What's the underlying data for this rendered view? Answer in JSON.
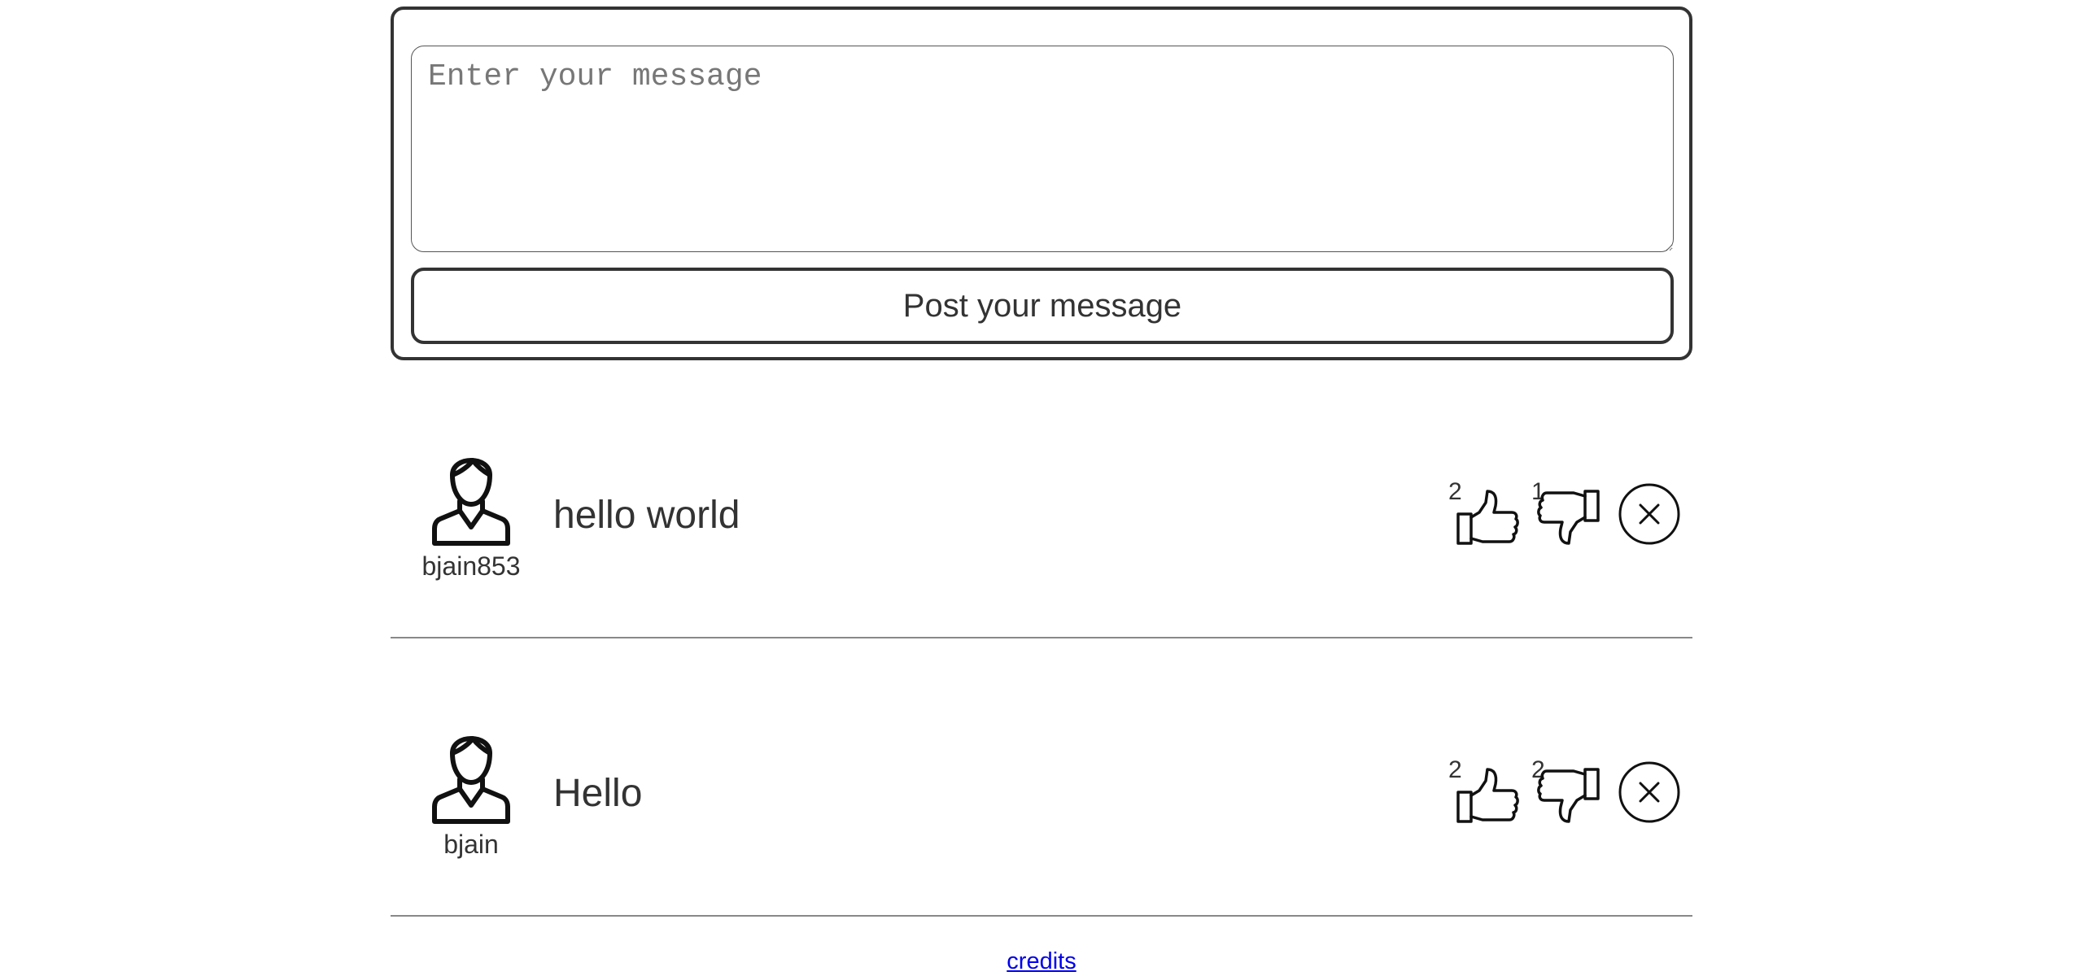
{
  "composer": {
    "placeholder": "Enter your message",
    "value": "",
    "post_label": "Post your message"
  },
  "posts": [
    {
      "username": "bjain853",
      "message": "hello world",
      "likes": "2",
      "dislikes": "1"
    },
    {
      "username": "bjain",
      "message": "Hello",
      "likes": "2",
      "dislikes": "2"
    }
  ],
  "footer": {
    "credits_label": "credits"
  },
  "icons": {
    "avatar": "user-avatar-icon",
    "like": "thumbs-up-icon",
    "dislike": "thumbs-down-icon",
    "delete": "close-circle-icon"
  },
  "colors": {
    "text": "#333333",
    "border": "#333333",
    "link": "#0000ee",
    "divider": "#888888"
  }
}
